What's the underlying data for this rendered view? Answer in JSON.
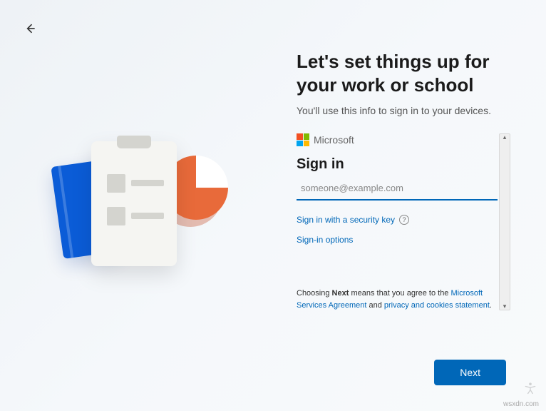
{
  "header": {
    "title": "Let's set things up for your work or school",
    "subtitle": "You'll use this info to sign in to your devices."
  },
  "brand": {
    "name": "Microsoft"
  },
  "signin": {
    "title": "Sign in",
    "email_placeholder": "someone@example.com",
    "security_key_link": "Sign in with a security key",
    "options_link": "Sign-in options"
  },
  "legal": {
    "prefix": "Choosing ",
    "bold_word": "Next",
    "mid1": " means that you agree to the ",
    "msa_link": "Microsoft Services Agreement",
    "mid2": " and ",
    "privacy_link": "privacy and cookies statement",
    "suffix": "."
  },
  "buttons": {
    "next": "Next"
  },
  "watermark": "wsxdn.com",
  "colors": {
    "accent": "#0067b8"
  }
}
